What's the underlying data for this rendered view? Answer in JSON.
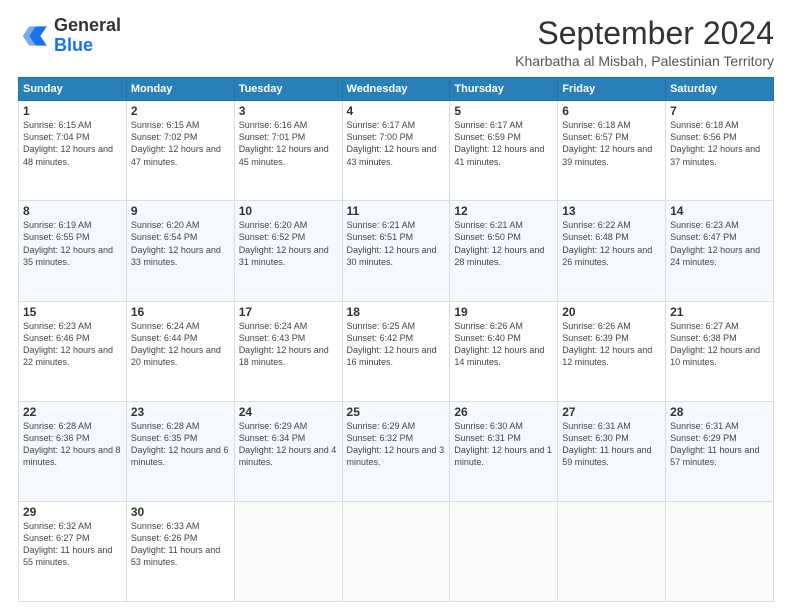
{
  "logo": {
    "general": "General",
    "blue": "Blue"
  },
  "header": {
    "month": "September 2024",
    "location": "Kharbatha al Misbah, Palestinian Territory"
  },
  "days_of_week": [
    "Sunday",
    "Monday",
    "Tuesday",
    "Wednesday",
    "Thursday",
    "Friday",
    "Saturday"
  ],
  "weeks": [
    [
      {
        "day": "1",
        "sunrise": "6:15 AM",
        "sunset": "7:04 PM",
        "daylight": "12 hours and 48 minutes."
      },
      {
        "day": "2",
        "sunrise": "6:15 AM",
        "sunset": "7:02 PM",
        "daylight": "12 hours and 47 minutes."
      },
      {
        "day": "3",
        "sunrise": "6:16 AM",
        "sunset": "7:01 PM",
        "daylight": "12 hours and 45 minutes."
      },
      {
        "day": "4",
        "sunrise": "6:17 AM",
        "sunset": "7:00 PM",
        "daylight": "12 hours and 43 minutes."
      },
      {
        "day": "5",
        "sunrise": "6:17 AM",
        "sunset": "6:59 PM",
        "daylight": "12 hours and 41 minutes."
      },
      {
        "day": "6",
        "sunrise": "6:18 AM",
        "sunset": "6:57 PM",
        "daylight": "12 hours and 39 minutes."
      },
      {
        "day": "7",
        "sunrise": "6:18 AM",
        "sunset": "6:56 PM",
        "daylight": "12 hours and 37 minutes."
      }
    ],
    [
      {
        "day": "8",
        "sunrise": "6:19 AM",
        "sunset": "6:55 PM",
        "daylight": "12 hours and 35 minutes."
      },
      {
        "day": "9",
        "sunrise": "6:20 AM",
        "sunset": "6:54 PM",
        "daylight": "12 hours and 33 minutes."
      },
      {
        "day": "10",
        "sunrise": "6:20 AM",
        "sunset": "6:52 PM",
        "daylight": "12 hours and 31 minutes."
      },
      {
        "day": "11",
        "sunrise": "6:21 AM",
        "sunset": "6:51 PM",
        "daylight": "12 hours and 30 minutes."
      },
      {
        "day": "12",
        "sunrise": "6:21 AM",
        "sunset": "6:50 PM",
        "daylight": "12 hours and 28 minutes."
      },
      {
        "day": "13",
        "sunrise": "6:22 AM",
        "sunset": "6:48 PM",
        "daylight": "12 hours and 26 minutes."
      },
      {
        "day": "14",
        "sunrise": "6:23 AM",
        "sunset": "6:47 PM",
        "daylight": "12 hours and 24 minutes."
      }
    ],
    [
      {
        "day": "15",
        "sunrise": "6:23 AM",
        "sunset": "6:46 PM",
        "daylight": "12 hours and 22 minutes."
      },
      {
        "day": "16",
        "sunrise": "6:24 AM",
        "sunset": "6:44 PM",
        "daylight": "12 hours and 20 minutes."
      },
      {
        "day": "17",
        "sunrise": "6:24 AM",
        "sunset": "6:43 PM",
        "daylight": "12 hours and 18 minutes."
      },
      {
        "day": "18",
        "sunrise": "6:25 AM",
        "sunset": "6:42 PM",
        "daylight": "12 hours and 16 minutes."
      },
      {
        "day": "19",
        "sunrise": "6:26 AM",
        "sunset": "6:40 PM",
        "daylight": "12 hours and 14 minutes."
      },
      {
        "day": "20",
        "sunrise": "6:26 AM",
        "sunset": "6:39 PM",
        "daylight": "12 hours and 12 minutes."
      },
      {
        "day": "21",
        "sunrise": "6:27 AM",
        "sunset": "6:38 PM",
        "daylight": "12 hours and 10 minutes."
      }
    ],
    [
      {
        "day": "22",
        "sunrise": "6:28 AM",
        "sunset": "6:36 PM",
        "daylight": "12 hours and 8 minutes."
      },
      {
        "day": "23",
        "sunrise": "6:28 AM",
        "sunset": "6:35 PM",
        "daylight": "12 hours and 6 minutes."
      },
      {
        "day": "24",
        "sunrise": "6:29 AM",
        "sunset": "6:34 PM",
        "daylight": "12 hours and 4 minutes."
      },
      {
        "day": "25",
        "sunrise": "6:29 AM",
        "sunset": "6:32 PM",
        "daylight": "12 hours and 3 minutes."
      },
      {
        "day": "26",
        "sunrise": "6:30 AM",
        "sunset": "6:31 PM",
        "daylight": "12 hours and 1 minute."
      },
      {
        "day": "27",
        "sunrise": "6:31 AM",
        "sunset": "6:30 PM",
        "daylight": "11 hours and 59 minutes."
      },
      {
        "day": "28",
        "sunrise": "6:31 AM",
        "sunset": "6:29 PM",
        "daylight": "11 hours and 57 minutes."
      }
    ],
    [
      {
        "day": "29",
        "sunrise": "6:32 AM",
        "sunset": "6:27 PM",
        "daylight": "11 hours and 55 minutes."
      },
      {
        "day": "30",
        "sunrise": "6:33 AM",
        "sunset": "6:26 PM",
        "daylight": "11 hours and 53 minutes."
      },
      null,
      null,
      null,
      null,
      null
    ]
  ]
}
